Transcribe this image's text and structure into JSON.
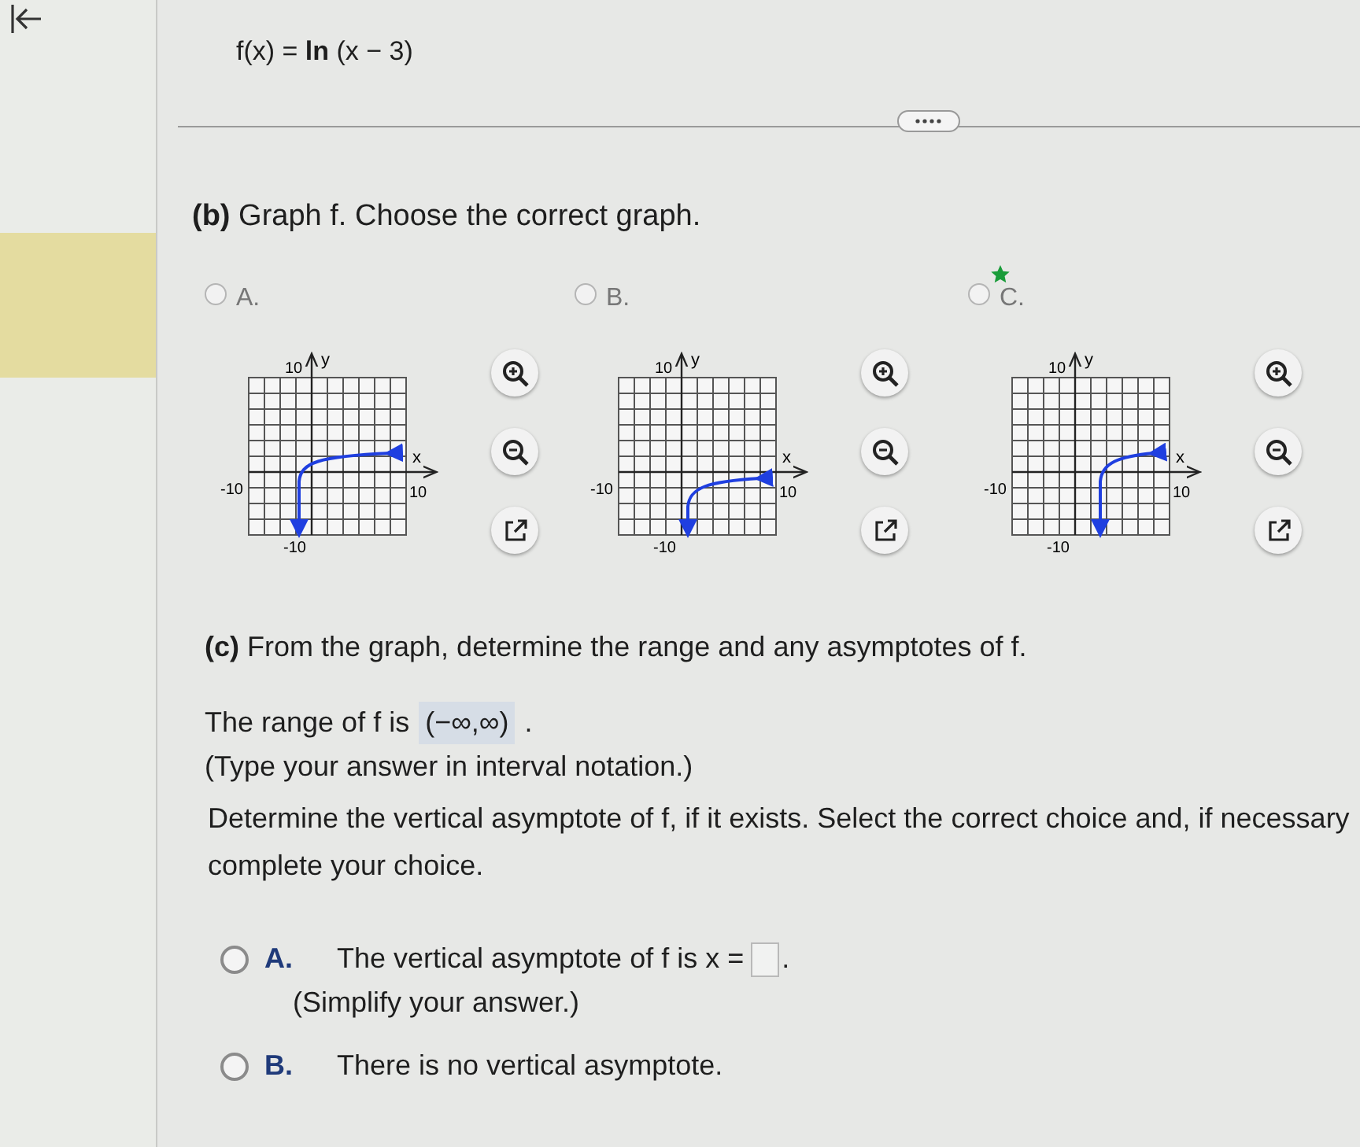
{
  "header": {
    "function": "f(x) = **ln** (x − 3)"
  },
  "part_b": {
    "prompt": "**(b)** Graph f. Choose the correct graph.",
    "options": [
      {
        "letter": "A.",
        "selected": false,
        "correct": false,
        "kind": "left",
        "y_label": "y",
        "x_label": "x",
        "y_max": "10",
        "y_min": "-10",
        "x_min": "-10",
        "x_max": "10"
      },
      {
        "letter": "B.",
        "selected": false,
        "correct": false,
        "kind": "origin",
        "y_label": "y",
        "x_label": "x",
        "y_max": "10",
        "y_min": "-10",
        "x_min": "-10",
        "x_max": "10"
      },
      {
        "letter": "C.",
        "selected": false,
        "correct": true,
        "kind": "right",
        "y_label": "y",
        "x_label": "x",
        "y_max": "10",
        "y_min": "-10",
        "x_min": "-10",
        "x_max": "10"
      }
    ]
  },
  "part_c": {
    "prompt": "**(c)** From the graph, determine the range and any asymptotes of f.",
    "range_label": "The range of f is",
    "range_answer": "(−∞,∞)",
    "range_end": ".",
    "range_hint": "(Type your answer in interval notation.)",
    "asymptote_prompt": "Determine the vertical asymptote of f, if it exists. Select the correct choice and, if necessary",
    "asymptote_prompt_2": "complete your choice.",
    "choices": [
      {
        "letter": "A.",
        "kind": "input",
        "selected": false,
        "text": "The vertical asymptote of f is x =",
        "end": ".",
        "hint": "(Simplify your answer.)"
      },
      {
        "letter": "B.",
        "kind": "plain",
        "selected": false,
        "text": "There is no vertical asymptote."
      }
    ]
  }
}
